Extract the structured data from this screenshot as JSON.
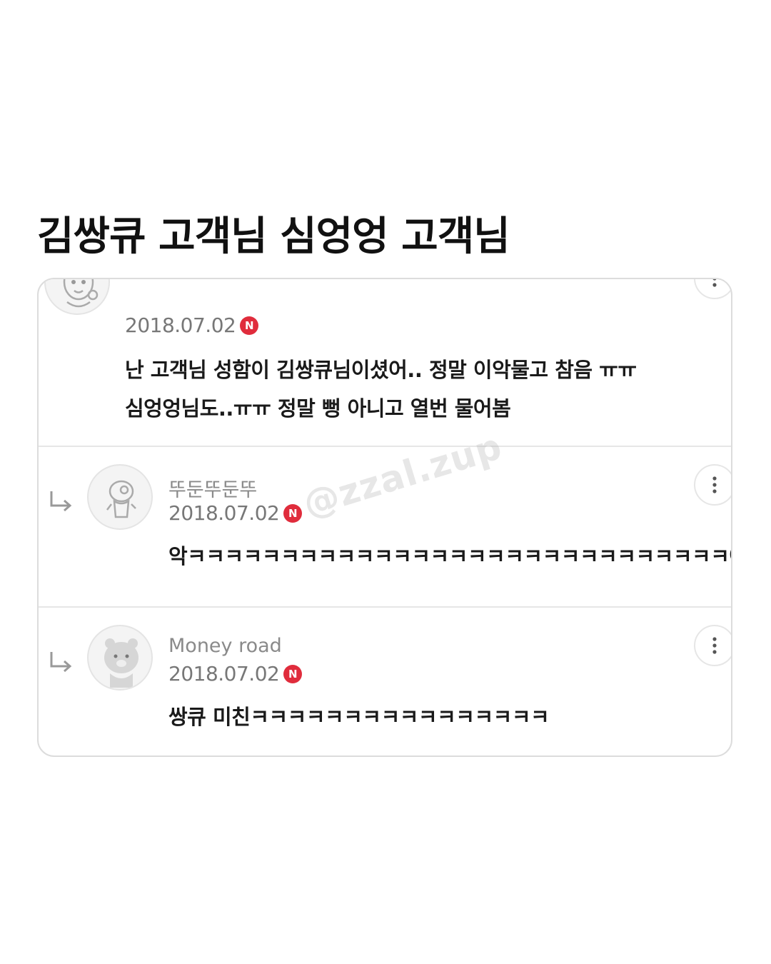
{
  "title": "김쌍큐 고객님 심엉엉 고객님",
  "watermark": "@zzal.zup",
  "badge_label": "N",
  "colors": {
    "badge": "#e02c3c",
    "date": "#777777",
    "nickname": "#8a8a8a",
    "text": "#1a1a1a"
  },
  "comments": [
    {
      "nickname": "",
      "date": "2018.07.02",
      "lines": [
        "난 고객님 성함이 김쌍큐님이셨어.. 정말 이악물고 참음 ㅠㅠ",
        "심엉엉님도..ㅠㅠ 정말 뻥 아니고 열번 물어봄"
      ],
      "avatar_icon": "character-avatar-icon"
    },
    {
      "nickname": "뚜둔뚜둔뚜",
      "date": "2018.07.02",
      "lines": [
        "악ㅋㅋㅋㅋㅋㅋㅋㅋㅋㅋㅋㅋㅋㅋㅋㅋㅋㅋㅋㅋㅋㅋㅋㅋㅋㅋㅋㅋㅋ아미친"
      ],
      "avatar_icon": "character-avatar-icon",
      "reply_icon": "reply-arrow-icon",
      "more_icon": "more-vertical-icon"
    },
    {
      "nickname": "Money road",
      "date": "2018.07.02",
      "lines": [
        "쌍큐 미친ㅋㅋㅋㅋㅋㅋㅋㅋㅋㅋㅋㅋㅋㅋㅋㅋ"
      ],
      "avatar_icon": "bear-avatar-icon",
      "reply_icon": "reply-arrow-icon",
      "more_icon": "more-vertical-icon"
    }
  ]
}
